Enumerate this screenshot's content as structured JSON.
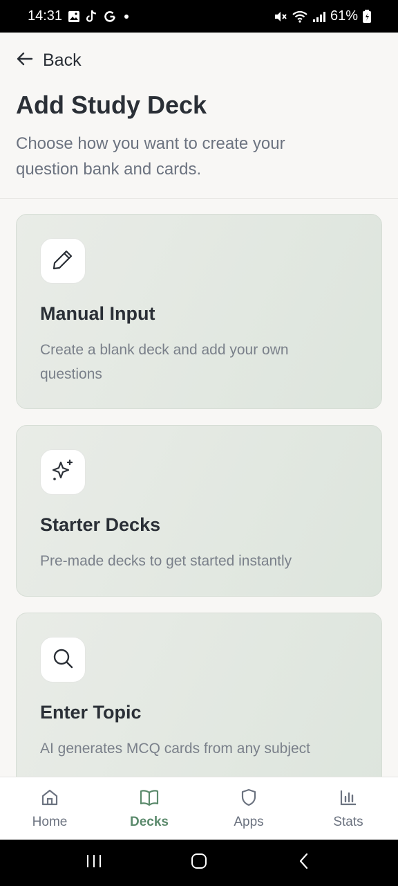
{
  "status_bar": {
    "time": "14:31",
    "left_icons": [
      "gallery-icon",
      "tiktok-icon",
      "google-icon",
      "dot-icon"
    ],
    "right_icons": [
      "mute-icon",
      "wifi-icon",
      "signal-icon"
    ],
    "battery_text": "61%"
  },
  "header": {
    "back_label": "Back",
    "title": "Add Study Deck",
    "subtitle": "Choose how you want to create your question bank and cards."
  },
  "cards": [
    {
      "icon": "pencil-icon",
      "title": "Manual Input",
      "description": "Create a blank deck and add your own questions"
    },
    {
      "icon": "sparkles-icon",
      "title": "Starter Decks",
      "description": "Pre-made decks to get started instantly"
    },
    {
      "icon": "search-icon",
      "title": "Enter Topic",
      "description": "AI generates MCQ cards from any subject"
    }
  ],
  "bottom_nav": {
    "items": [
      {
        "label": "Home",
        "icon": "home-icon",
        "active": false
      },
      {
        "label": "Decks",
        "icon": "book-icon",
        "active": true
      },
      {
        "label": "Apps",
        "icon": "shield-icon",
        "active": false
      },
      {
        "label": "Stats",
        "icon": "bar-chart-icon",
        "active": false
      }
    ]
  },
  "colors": {
    "accent": "#5b8a6c",
    "card_bg": "#e3e9e2",
    "text_primary": "#2a2f36",
    "text_secondary": "#6c7380"
  }
}
